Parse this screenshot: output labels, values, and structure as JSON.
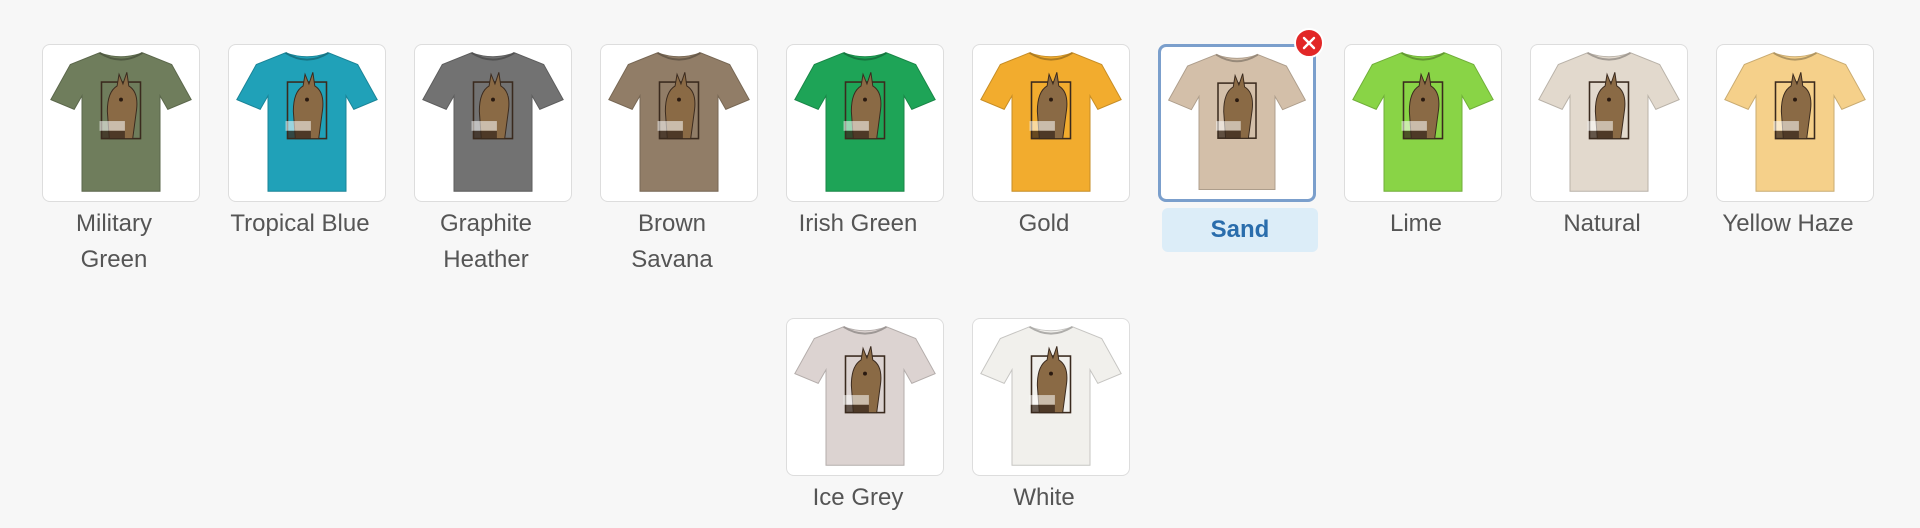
{
  "selected_color": "Sand",
  "colors": [
    {
      "name": "Military Green",
      "line1": "Military",
      "line2": "Green",
      "shirt": "#6f7d5c"
    },
    {
      "name": "Tropical Blue",
      "line1": "Tropical Blue",
      "line2": "",
      "shirt": "#20a1b8"
    },
    {
      "name": "Graphite Heather",
      "line1": "Graphite",
      "line2": "Heather",
      "shirt": "#727272"
    },
    {
      "name": "Brown Savana",
      "line1": "Brown",
      "line2": "Savana",
      "shirt": "#917d67"
    },
    {
      "name": "Irish Green",
      "line1": "Irish Green",
      "line2": "",
      "shirt": "#1ea457"
    },
    {
      "name": "Gold",
      "line1": "Gold",
      "line2": "",
      "shirt": "#f2ac2e"
    },
    {
      "name": "Sand",
      "line1": "Sand",
      "line2": "",
      "shirt": "#d3bfa9"
    },
    {
      "name": "Lime",
      "line1": "Lime",
      "line2": "",
      "shirt": "#89d446"
    },
    {
      "name": "Natural",
      "line1": "Natural",
      "line2": "",
      "shirt": "#e2d9cd"
    },
    {
      "name": "Yellow Haze",
      "line1": "Yellow Haze",
      "line2": "",
      "shirt": "#f5d08a"
    },
    {
      "name": "Ice Grey",
      "line1": "Ice Grey",
      "line2": "",
      "shirt": "#dcd3d1"
    },
    {
      "name": "White",
      "line1": "White",
      "line2": "",
      "shirt": "#f1f0ec"
    }
  ],
  "icons": {
    "remove": "close-icon",
    "product": "tshirt-icon"
  },
  "accent_colors": {
    "selected_border": "#7b9fcc",
    "selected_label_bg": "#dcedf8",
    "selected_label_text": "#2a6dac",
    "remove_button": "#e22727"
  }
}
